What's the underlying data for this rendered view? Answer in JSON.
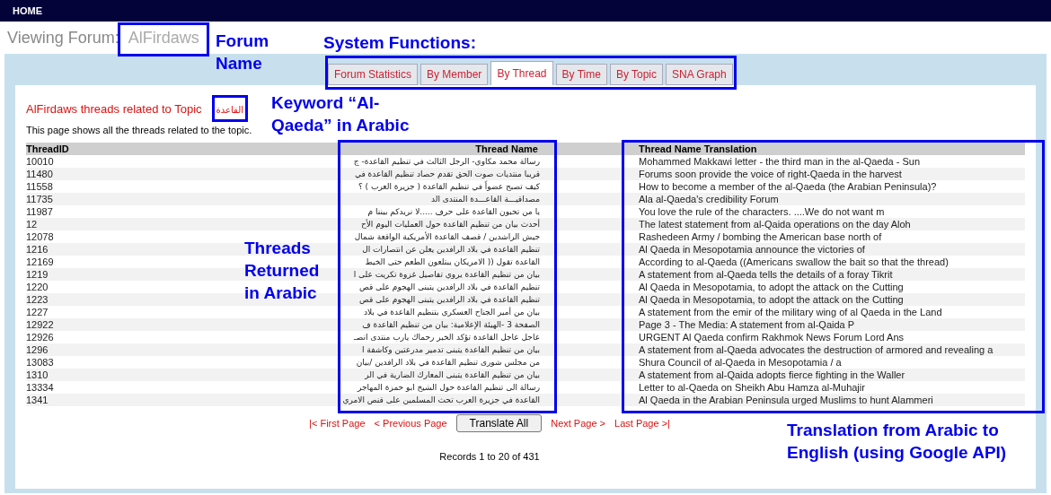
{
  "nav": {
    "home": "HOME"
  },
  "forum": {
    "label": "Viewing Forum:",
    "name": "AlFirdaws"
  },
  "tabs": [
    {
      "label": "Forum Statistics",
      "selected": false
    },
    {
      "label": "By Member",
      "selected": false
    },
    {
      "label": "By Thread",
      "selected": true
    },
    {
      "label": "By Time",
      "selected": false
    },
    {
      "label": "By Topic",
      "selected": false
    },
    {
      "label": "SNA Graph",
      "selected": false
    }
  ],
  "topic": {
    "heading": "AlFirdaws threads related to Topic",
    "keyword": "القاعدة",
    "description": "This page shows all the threads related to the topic."
  },
  "table": {
    "columns": [
      "ThreadID",
      "Thread Name",
      "Thread Name Translation"
    ],
    "rows": [
      [
        "10010",
        "رسالة محمد مكاوي- الرجل الثالث في تنظيم القاعدة- ج",
        "Mohammed Makkawi letter - the third man in the al-Qaeda - Sun"
      ],
      [
        "11480",
        "قريبا منتديات صوت الحق تقدم حصاد تنظيم القاعدة في",
        "Forums soon provide the voice of right-Qaeda in the harvest"
      ],
      [
        "11558",
        "كيف تصبح عضواً في تنظيم القاعدة ( جزيرة العرب ) ؟",
        "How to become a member of the al-Qaeda (the Arabian Peninsula)?"
      ],
      [
        "11735",
        "مصداقيـــة القاعـــدة المنتدى الد",
        "Ala al-Qaeda's credibility Forum"
      ],
      [
        "11987",
        "يا من تحبون القاعدة على حرف .....لا نريدكم بيننا م",
        "You love the rule of the characters. ....We do not want m"
      ],
      [
        "12",
        "أحدث بيان من تنظيم القاعدة حول العمليات اليوم الأح",
        "The latest statement from al-Qaida operations on the day Aloh"
      ],
      [
        "12078",
        "جيش الراشدين / قصف القاعدة الأمريكية الواقعة شمال",
        "Rashedeen Army / bombing the American base north of"
      ],
      [
        "1216",
        "تنظيم القاعدة في بلاد الرافدين يعلن عن انتصارات ال",
        "Al Qaeda in Mesopotamia announce the victories of"
      ],
      [
        "12169",
        "القاعدة تقول (( الامريكان يبتلعون الطعم حتى الخيط",
        "According to al-Qaeda ((Americans swallow the bait so that the thread)"
      ],
      [
        "1219",
        "بيان من تنظيم القاعدة يروي تفاصيل غزوة تكريت على ا",
        "A statement from al-Qaeda tells the details of a foray Tikrit"
      ],
      [
        "1220",
        "تنظيم القاعدة في بلاد الرافدين يتبنى الهجوم على قص",
        "Al Qaeda in Mesopotamia, to adopt the attack on the Cutting"
      ],
      [
        "1223",
        "تنظيم القاعدة في بلاد الرافدين يتبنى الهجوم على قص",
        "Al Qaeda in Mesopotamia, to adopt the attack on the Cutting"
      ],
      [
        "1227",
        "بيان من أمير الجناح العسكري بتنظيم القاعدة في بلاد",
        "A statement from the emir of the military wing of al Qaeda in the Land"
      ],
      [
        "12922",
        "الصفحة 3 -الهيئة الإعلامية: بيان من تنظيم القاعدة ف",
        "Page 3 - The Media: A statement from al-Qaida P"
      ],
      [
        "12926",
        "عاجل عاجل القاعدة تؤكد الخبر رحماك يارب منتدى انصـ",
        "URGENT Al Qaeda confirm Rakhmok News Forum Lord Ans"
      ],
      [
        "1296",
        "بيان من تنظيم القاعدة يتبنى تدمير مدرعتين وكاشفة ا",
        "A statement from al-Qaeda advocates the destruction of armored and revealing a"
      ],
      [
        "13083",
        "من مجلس شورى تنظيم القاعدة في بلاد الرافدين /بيان",
        "Shura Council of al-Qaeda in Mesopotamia / a"
      ],
      [
        "1310",
        "بيان من تنظيم القاعدة يتبنى المعارك الضارية في الر",
        "A statement from al-Qaida adopts fierce fighting in the Waller"
      ],
      [
        "13334",
        "رسالة الى تنظيم القاعدة حول الشيخ ابو حمزة المهاجر",
        "Letter to al-Qaeda on Sheikh Abu Hamza al-Muhajir"
      ],
      [
        "1341",
        "القاعدة في جزيرة العرب تحث المسلمين على قنص الامري",
        "Al Qaeda in the Arabian Peninsula urged Muslims to hunt Alammeri"
      ]
    ]
  },
  "pager": {
    "first": "|< First Page",
    "previous": "< Previous Page",
    "button": "Translate All",
    "next": "Next Page >",
    "last": "Last Page >|",
    "records": "Records 1 to 20 of 431"
  },
  "annotations": [
    "Forum Name",
    "System Functions:",
    "Keyword “Al-Qaeda” in Arabic",
    "Threads Returned in Arabic",
    "Translation from Arabic to English (using Google API)"
  ]
}
